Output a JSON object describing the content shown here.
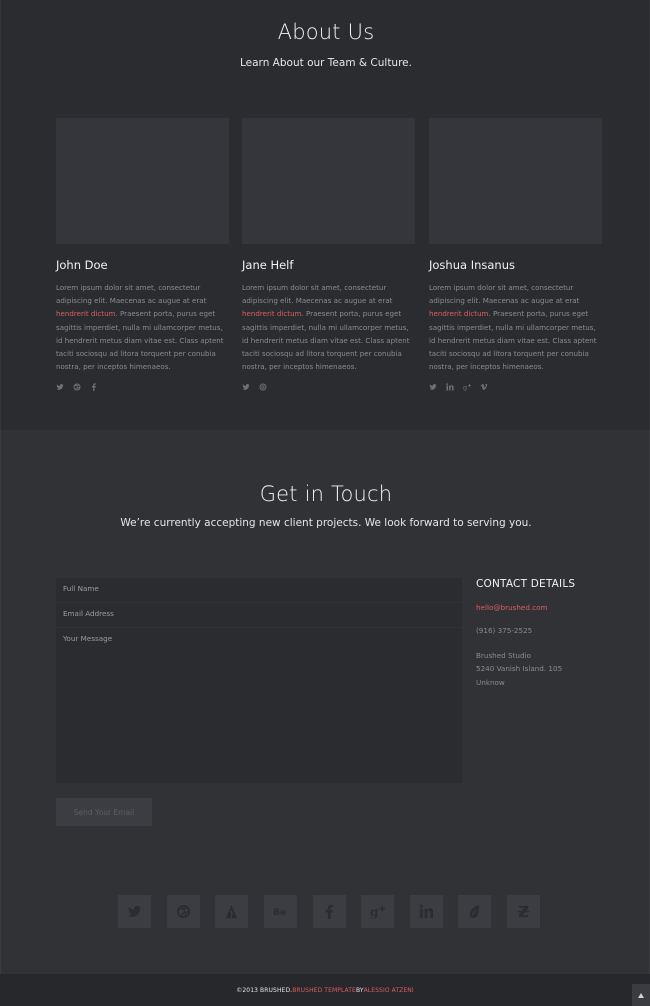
{
  "about": {
    "title": "About Us",
    "subtitle": "Learn About our Team & Culture.",
    "members": [
      {
        "name": "John Doe",
        "bio_pre": "Lorem ipsum dolor sit amet, consectetur adipiscing elit. Maecenas ac augue at erat ",
        "bio_link": "hendrerit dictum",
        "bio_post": ". Praesent porta, purus eget sagittis imperdiet, nulla mi ullamcorper metus, id hendrerit metus diam vitae est. Class aptent taciti sociosqu ad litora torquent per conubia nostra, per inceptos himenaeos.",
        "social": [
          "twitter-icon",
          "dribbble-icon",
          "facebook-icon"
        ]
      },
      {
        "name": "Jane Helf",
        "bio_pre": "Lorem ipsum dolor sit amet, consectetur adipiscing elit. Maecenas ac augue at erat ",
        "bio_link": "hendrerit dictum",
        "bio_post": ". Praesent porta, purus eget sagittis imperdiet, nulla mi ullamcorper metus, id hendrerit metus diam vitae est. Class aptent taciti sociosqu ad litora torquent per conubia nostra, per inceptos himenaeos.",
        "social": [
          "twitter-icon",
          "email-icon"
        ]
      },
      {
        "name": "Joshua Insanus",
        "bio_pre": "Lorem ipsum dolor sit amet, consectetur adipiscing elit. Maecenas ac augue at erat ",
        "bio_link": "hendrerit dictum",
        "bio_post": ". Praesent porta, purus eget sagittis imperdiet, nulla mi ullamcorper metus, id hendrerit metus diam vitae est. Class aptent taciti sociosqu ad litora torquent per conubia nostra, per inceptos himenaeos.",
        "social": [
          "twitter-icon",
          "linkedin-icon",
          "googleplus-icon",
          "vimeo-icon"
        ]
      }
    ]
  },
  "contact": {
    "title": "Get in Touch",
    "subtitle": "We’re currently accepting new client projects. We look forward to serving you.",
    "form": {
      "name_placeholder": "Full Name",
      "email_placeholder": "Email Address",
      "message_placeholder": "Your Message",
      "send_label": "Send Your Email"
    },
    "details": {
      "heading": "CONTACT DETAILS",
      "email": "hello@brushed.com",
      "phone": "(916) 375-2525",
      "address_line1": "Brushed Studio",
      "address_line2": "5240 Vanish Island. 105",
      "address_line3": "Unknow"
    },
    "social_bar": [
      "twitter-icon",
      "dribbble-icon",
      "forrst-icon",
      "behance-icon",
      "facebook-icon",
      "googleplus-icon",
      "linkedin-icon",
      "envato-icon",
      "zerply-icon"
    ]
  },
  "footer": {
    "copy": "©2013 BRUSHED. ",
    "template_link": "BRUSHED TEMPLATE",
    "by": " BY ",
    "author_link": "ALESSIO ATZENI"
  },
  "colors": {
    "accent": "#de5e60",
    "bg_about": "#2a2c30",
    "bg_contact": "#303236",
    "bg_footer": "#26282c"
  }
}
